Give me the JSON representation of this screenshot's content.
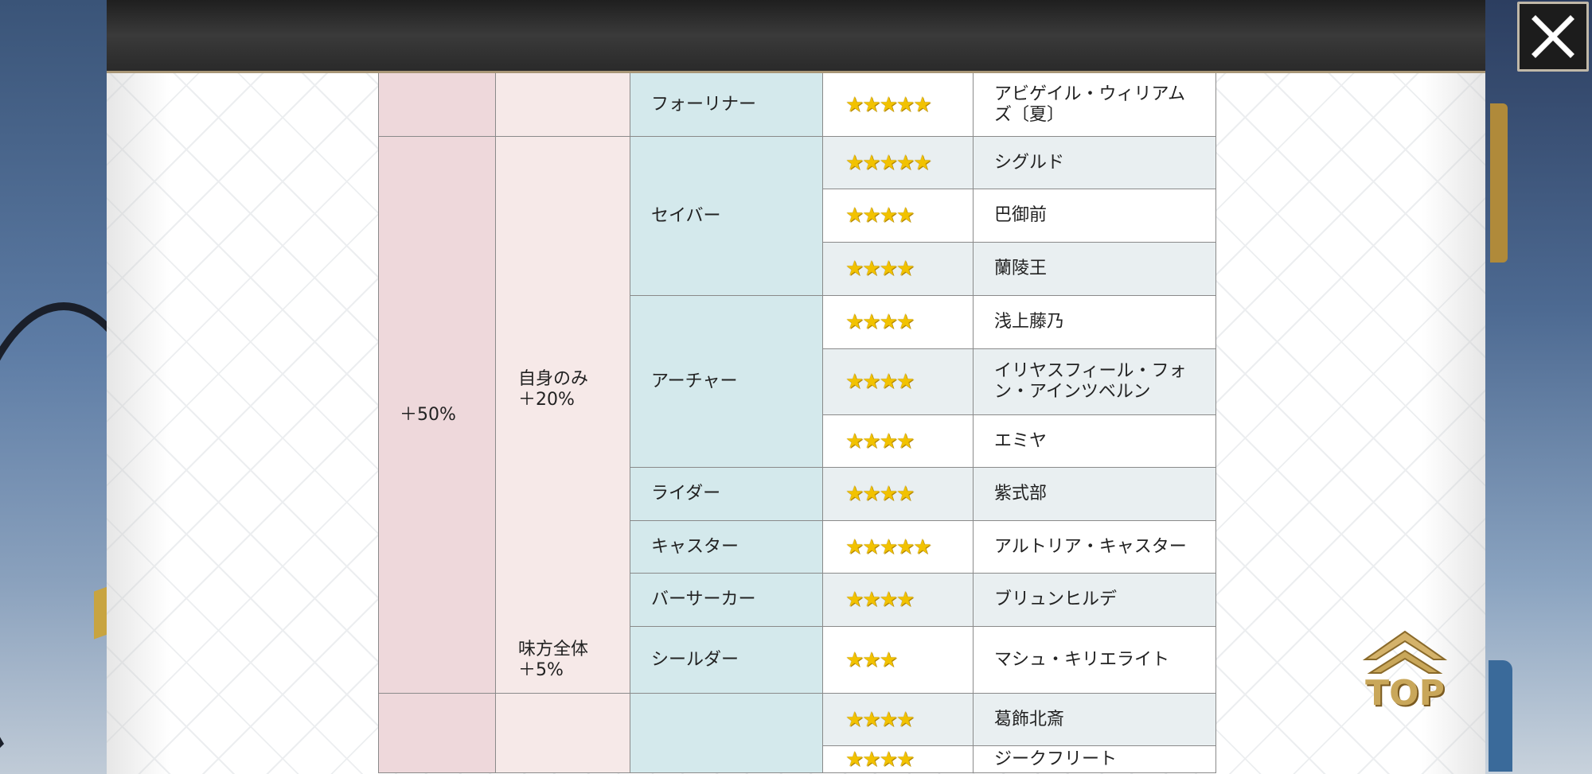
{
  "close_label": "",
  "top_label": "TOP",
  "colors": {
    "bonus": "#eed8db",
    "effect": "#f6e9e8",
    "class": "#d4e9ec",
    "star": "#f2c200"
  },
  "table": {
    "cells": [
      {
        "col": 1,
        "row": "1/2",
        "cls": "c-bonus",
        "text": ""
      },
      {
        "col": 2,
        "row": "1/2",
        "cls": "c-effect",
        "text": ""
      },
      {
        "col": 3,
        "row": "1/2",
        "cls": "c-class",
        "text": "フォーリナー"
      },
      {
        "col": 4,
        "row": "1/2",
        "cls": "c-rarity plain",
        "stars": "★★★★★"
      },
      {
        "col": 5,
        "row": "1/2",
        "cls": "c-name plain",
        "text": "アビゲイル・ウィリアムズ〔夏〕"
      },
      {
        "col": 1,
        "row": "2/13",
        "cls": "c-bonus",
        "text": "＋50%"
      },
      {
        "col": 2,
        "row": "2/12",
        "cls": "c-effect",
        "text": "自身のみ\n＋20%"
      },
      {
        "col": 3,
        "row": "2/5",
        "cls": "c-class",
        "text": "セイバー"
      },
      {
        "col": 4,
        "row": "2/3",
        "cls": "c-rarity alt",
        "stars": "★★★★★"
      },
      {
        "col": 5,
        "row": "2/3",
        "cls": "c-name alt",
        "text": "シグルド"
      },
      {
        "col": 4,
        "row": "3/4",
        "cls": "c-rarity plain",
        "stars": "★★★★"
      },
      {
        "col": 5,
        "row": "3/4",
        "cls": "c-name plain",
        "text": "巴御前"
      },
      {
        "col": 4,
        "row": "4/5",
        "cls": "c-rarity alt",
        "stars": "★★★★"
      },
      {
        "col": 5,
        "row": "4/5",
        "cls": "c-name alt",
        "text": "蘭陵王"
      },
      {
        "col": 3,
        "row": "5/8",
        "cls": "c-class",
        "text": "アーチャー"
      },
      {
        "col": 4,
        "row": "5/6",
        "cls": "c-rarity plain",
        "stars": "★★★★"
      },
      {
        "col": 5,
        "row": "5/6",
        "cls": "c-name plain",
        "text": "浅上藤乃"
      },
      {
        "col": 4,
        "row": "6/7",
        "cls": "c-rarity alt",
        "stars": "★★★★"
      },
      {
        "col": 5,
        "row": "6/7",
        "cls": "c-name alt",
        "text": "イリヤスフィール・フォン・アインツベルン"
      },
      {
        "col": 4,
        "row": "7/8",
        "cls": "c-rarity plain",
        "stars": "★★★★"
      },
      {
        "col": 5,
        "row": "7/8",
        "cls": "c-name plain",
        "text": "エミヤ"
      },
      {
        "col": 3,
        "row": "8/9",
        "cls": "c-class",
        "text": "ライダー"
      },
      {
        "col": 4,
        "row": "8/9",
        "cls": "c-rarity alt",
        "stars": "★★★★"
      },
      {
        "col": 5,
        "row": "8/9",
        "cls": "c-name alt",
        "text": "紫式部"
      },
      {
        "col": 3,
        "row": "9/10",
        "cls": "c-class",
        "text": "キャスター"
      },
      {
        "col": 4,
        "row": "9/10",
        "cls": "c-rarity plain",
        "stars": "★★★★★"
      },
      {
        "col": 5,
        "row": "9/10",
        "cls": "c-name plain",
        "text": "アルトリア・キャスター"
      },
      {
        "col": 3,
        "row": "10/11",
        "cls": "c-class",
        "text": "バーサーカー"
      },
      {
        "col": 4,
        "row": "10/11",
        "cls": "c-rarity alt",
        "stars": "★★★★"
      },
      {
        "col": 5,
        "row": "10/11",
        "cls": "c-name alt",
        "text": "ブリュンヒルデ"
      },
      {
        "col": 2,
        "row": "11/13",
        "cls": "c-effect",
        "text": "味方全体\n＋5%"
      },
      {
        "col": 3,
        "row": "11/13",
        "cls": "c-class",
        "text": "シールダー"
      },
      {
        "col": 4,
        "row": "11/13",
        "cls": "c-rarity plain",
        "stars": "★★★"
      },
      {
        "col": 5,
        "row": "11/13",
        "cls": "c-name plain",
        "text": "マシュ・キリエライト"
      },
      {
        "col": 1,
        "row": "13/15",
        "cls": "c-bonus",
        "text": ""
      },
      {
        "col": 2,
        "row": "13/15",
        "cls": "c-effect",
        "text": ""
      },
      {
        "col": 3,
        "row": "13/15",
        "cls": "c-class",
        "text": ""
      },
      {
        "col": 4,
        "row": "13/14",
        "cls": "c-rarity alt",
        "stars": "★★★★"
      },
      {
        "col": 5,
        "row": "13/14",
        "cls": "c-name alt",
        "text": "葛飾北斎"
      },
      {
        "col": 4,
        "row": "14/15",
        "cls": "c-rarity plain",
        "stars": "★★★★"
      },
      {
        "col": 5,
        "row": "14/15",
        "cls": "c-name plain",
        "text": "ジークフリート"
      }
    ]
  }
}
